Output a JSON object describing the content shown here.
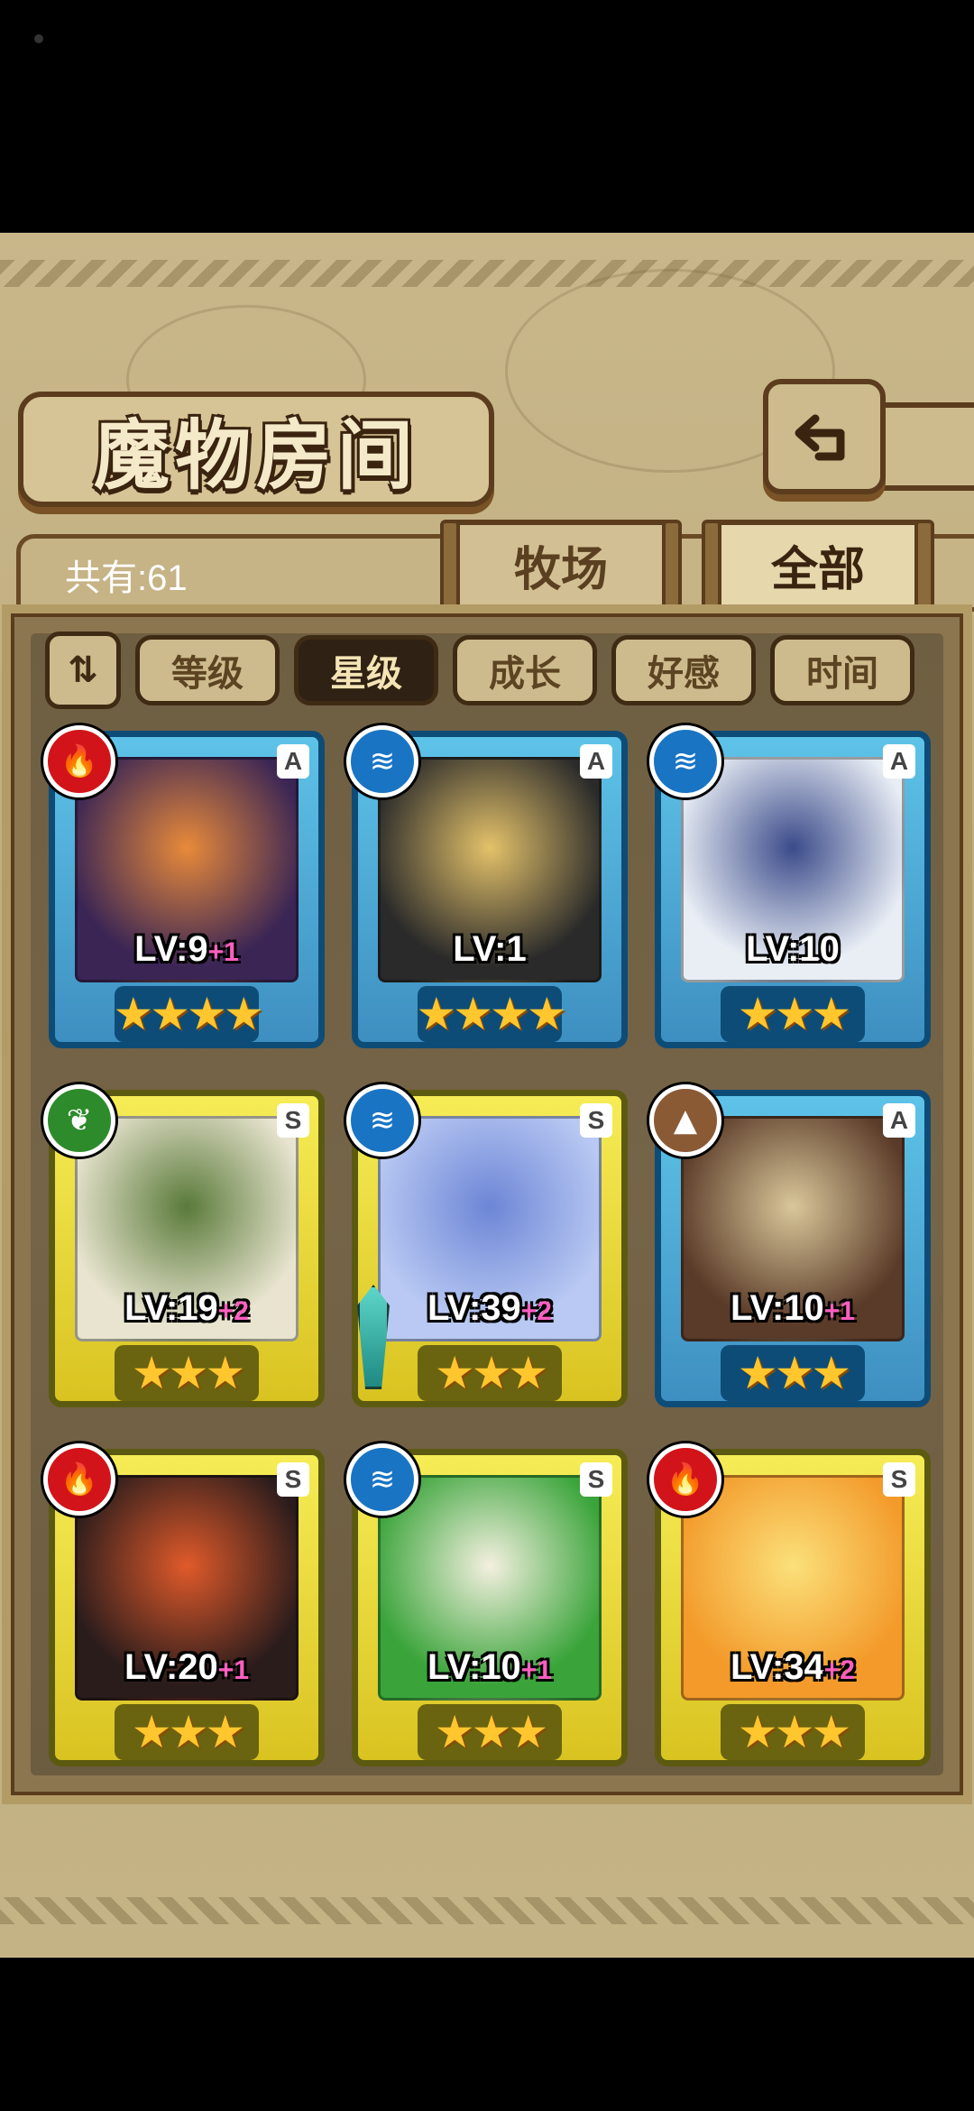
{
  "title": "魔物房间",
  "count_label": "共有:61",
  "tabs": [
    {
      "label": "牧场",
      "active": false
    },
    {
      "label": "全部",
      "active": true
    }
  ],
  "sort_buttons": [
    {
      "label": "等级",
      "active": false
    },
    {
      "label": "星级",
      "active": true
    },
    {
      "label": "成长",
      "active": false
    },
    {
      "label": "好感",
      "active": false
    },
    {
      "label": "时间",
      "active": false
    }
  ],
  "cards": [
    {
      "element": "fire",
      "rank": "A",
      "level": "LV:9",
      "plus": "+1",
      "stars": 4,
      "colors": [
        "#3a2555",
        "#e88a3a"
      ]
    },
    {
      "element": "water",
      "rank": "A",
      "level": "LV:1",
      "plus": "",
      "stars": 4,
      "colors": [
        "#2a2a2a",
        "#e4c26a"
      ]
    },
    {
      "element": "water",
      "rank": "A",
      "level": "LV:10",
      "plus": "",
      "stars": 3,
      "colors": [
        "#e9eef5",
        "#3b4b8a"
      ]
    },
    {
      "element": "wind",
      "rank": "S",
      "level": "LV:19",
      "plus": "+2",
      "stars": 3,
      "colors": [
        "#e8e4cf",
        "#5a7a3a"
      ]
    },
    {
      "element": "water",
      "rank": "S",
      "level": "LV:39",
      "plus": "+2",
      "stars": 3,
      "colors": [
        "#b9c9f3",
        "#6d86d6"
      ]
    },
    {
      "element": "earth",
      "rank": "A",
      "level": "LV:10",
      "plus": "+1",
      "stars": 3,
      "colors": [
        "#5a3a28",
        "#d9c79a"
      ]
    },
    {
      "element": "fire",
      "rank": "S",
      "level": "LV:20",
      "plus": "+1",
      "stars": 3,
      "colors": [
        "#2b1c1c",
        "#e05a2a"
      ]
    },
    {
      "element": "water",
      "rank": "S",
      "level": "LV:10",
      "plus": "+1",
      "stars": 3,
      "colors": [
        "#3aa43a",
        "#f4f0e0"
      ]
    },
    {
      "element": "fire",
      "rank": "S",
      "level": "LV:34",
      "plus": "+2",
      "stars": 3,
      "colors": [
        "#f39a2a",
        "#fbe07a"
      ]
    }
  ],
  "icons": {
    "back": "back-arrow-icon",
    "sort_toggle": "sort-order-icon",
    "fire": "fire-element-icon",
    "water": "water-element-icon",
    "wind": "wind-element-icon",
    "earth": "earth-element-icon"
  },
  "colors": {
    "rank_a_frame": "#5ec3e8",
    "rank_s_frame": "#f6ec56",
    "star": "#ffc62e",
    "plus_text": "#ff5fc0"
  }
}
